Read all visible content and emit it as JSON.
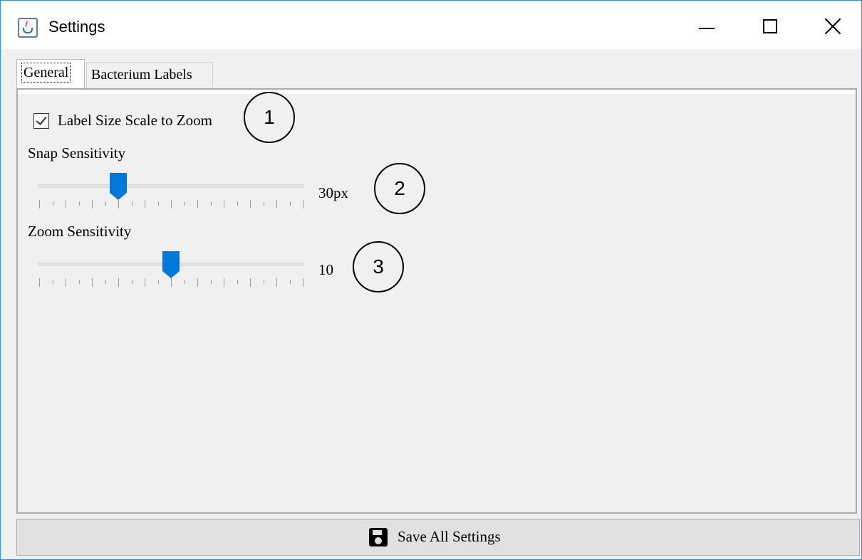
{
  "window": {
    "title": "Settings",
    "icon": "java-cup-icon",
    "controls": {
      "minimize": "minimize-icon",
      "maximize": "maximize-icon",
      "close": "close-icon"
    }
  },
  "tabs": [
    {
      "label": "General",
      "selected": true
    },
    {
      "label": "Bacterium Labels",
      "selected": false
    }
  ],
  "general": {
    "label_scale": {
      "label": "Label Size Scale to Zoom",
      "checked": true
    },
    "snap": {
      "label": "Snap Sensitivity",
      "value": "30px",
      "position_fraction": 0.3
    },
    "zoom": {
      "label": "Zoom Sensitivity",
      "value": "10",
      "position_fraction": 0.5
    }
  },
  "callouts": [
    "1",
    "2",
    "3"
  ],
  "footer": {
    "save_label": "Save All Settings",
    "save_icon": "floppy-disk-icon"
  },
  "colors": {
    "accent": "#0078d7",
    "window_border": "#3c8bd9"
  }
}
